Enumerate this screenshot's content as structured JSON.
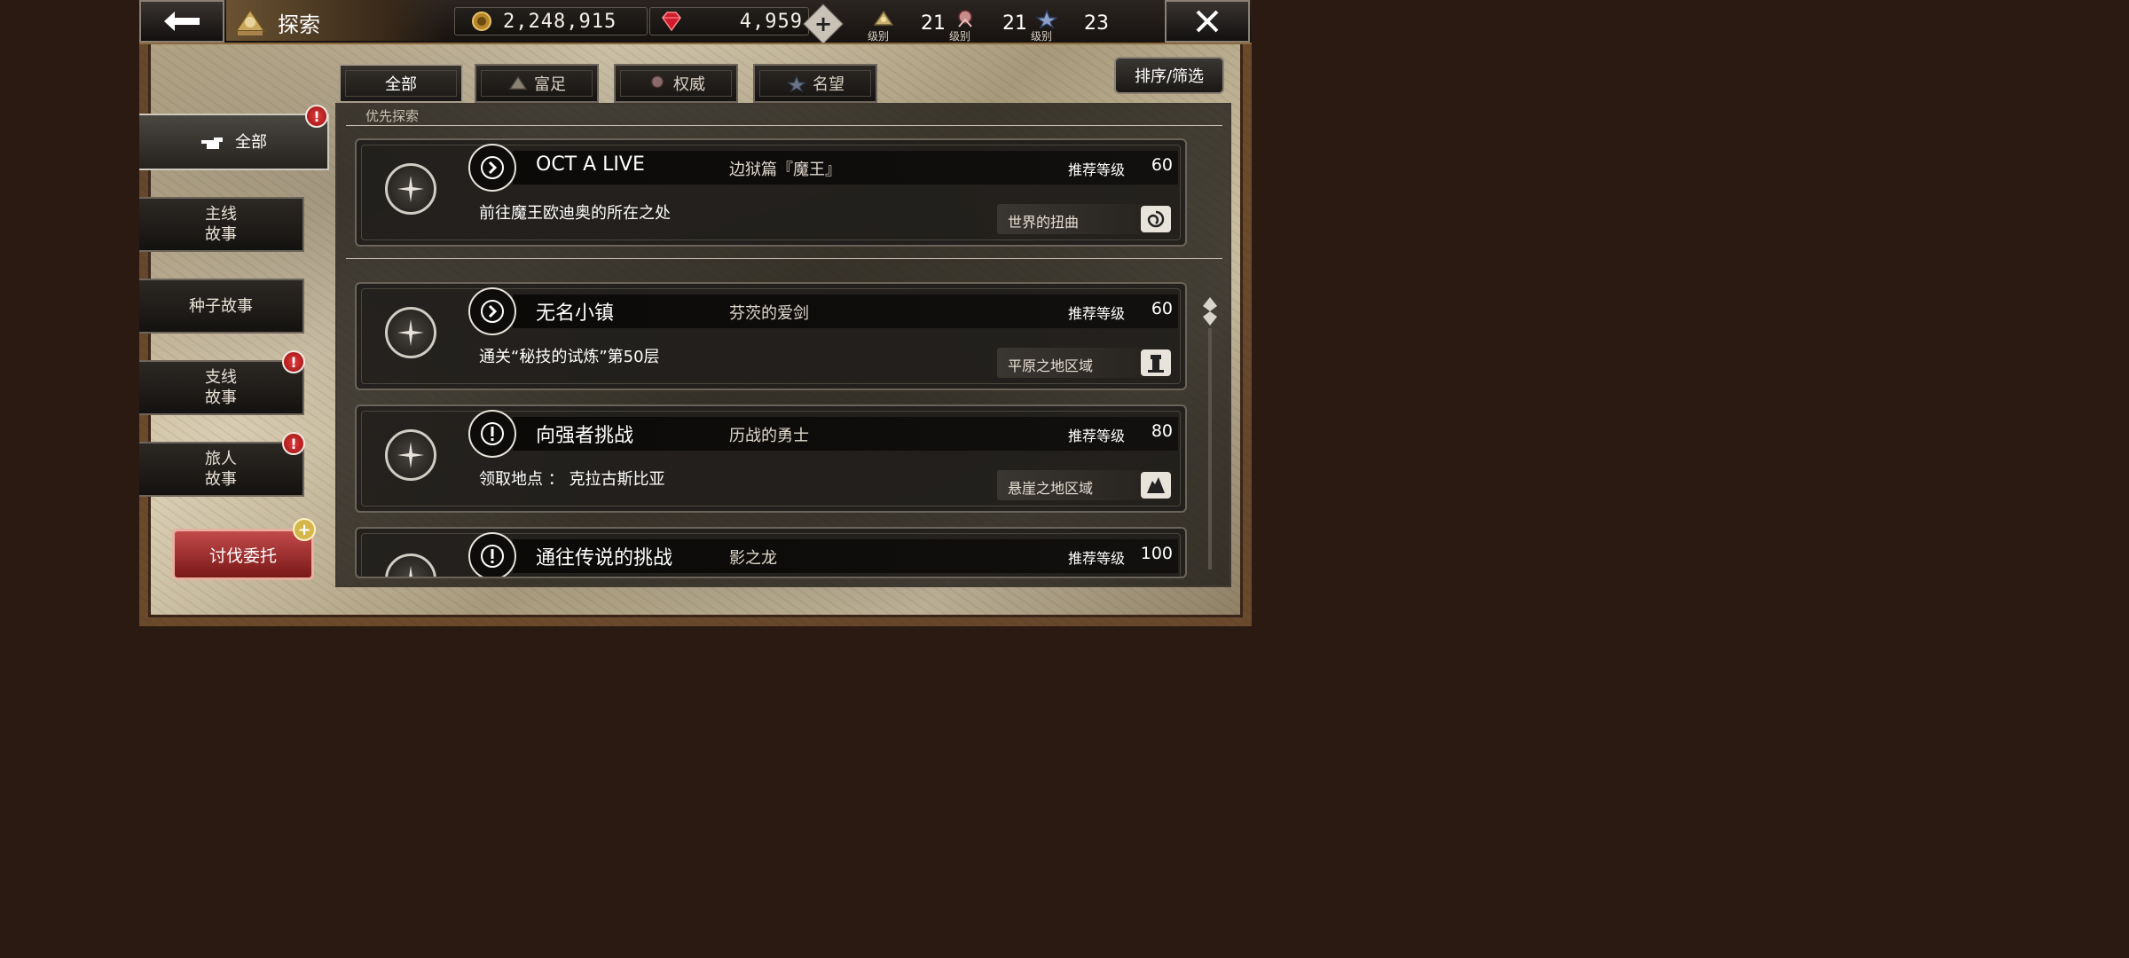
{
  "header": {
    "title": "探索",
    "back_icon": "back-arrow-icon",
    "close_icon": "close-icon"
  },
  "currencies": [
    {
      "icon": "coin-icon",
      "value": "2,248,915"
    },
    {
      "icon": "gem-icon",
      "value": "4,959"
    }
  ],
  "levels": [
    {
      "icon": "wealth-icon",
      "label": "级别",
      "value": "21"
    },
    {
      "icon": "power-icon",
      "label": "级别",
      "value": "21"
    },
    {
      "icon": "fame-icon",
      "label": "级别",
      "value": "23"
    }
  ],
  "tabs": [
    {
      "label": "全部",
      "active": true
    },
    {
      "label": "富足",
      "icon": "wealth-icon"
    },
    {
      "label": "权威",
      "icon": "power-icon"
    },
    {
      "label": "名望",
      "icon": "fame-icon"
    }
  ],
  "sort_label": "排序/筛选",
  "sidebar": {
    "items": [
      {
        "label": "全部",
        "active": true,
        "badge": "!"
      },
      {
        "label": "主线\n故事"
      },
      {
        "label": "种子故事"
      },
      {
        "label": "支线\n故事",
        "badge": "!"
      },
      {
        "label": "旅人\n故事",
        "badge": "!"
      }
    ],
    "hunt_label": "讨伐委托"
  },
  "section_label": "优先探索",
  "quests": [
    {
      "name": "OCT A LIVE",
      "subtitle": "边狱篇『魔王』",
      "rec_label": "推荐等级",
      "rec_level": "60",
      "description": "前往魔王欧迪奥的所在之处",
      "region": "世界的扭曲",
      "type": "arrow",
      "region_icon": "vortex-icon"
    },
    {
      "name": "无名小镇",
      "subtitle": "芬茨的爱剑",
      "rec_label": "推荐等级",
      "rec_level": "60",
      "description": "通关“秘技的试炼”第50层",
      "region": "平原之地区域",
      "type": "arrow",
      "region_icon": "tower-icon"
    },
    {
      "name": "向强者挑战",
      "subtitle": "历战的勇士",
      "rec_label": "推荐等级",
      "rec_level": "80",
      "description": "领取地点 ： 克拉古斯比亚",
      "region": "悬崖之地区域",
      "type": "exclaim",
      "region_icon": "cliff-icon"
    },
    {
      "name": "通往传说的挑战",
      "subtitle": "影之龙",
      "rec_label": "推荐等级",
      "rec_level": "100",
      "description": "",
      "region": "",
      "type": "exclaim",
      "region_icon": ""
    }
  ]
}
